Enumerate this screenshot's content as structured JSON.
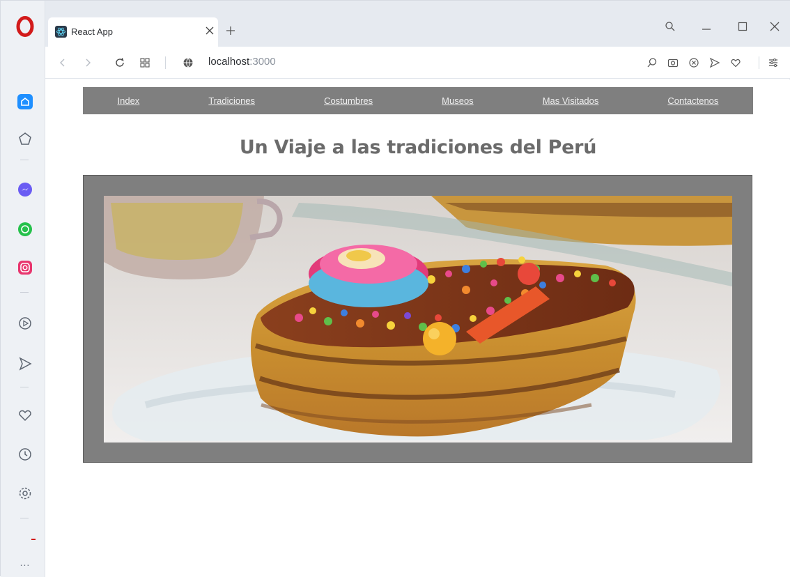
{
  "browser": {
    "tab_title": "React App",
    "url_host": "localhost",
    "url_port": ":3000"
  },
  "nav": {
    "items": [
      {
        "label": "Index"
      },
      {
        "label": "Tradiciones"
      },
      {
        "label": "Costumbres"
      },
      {
        "label": "Museos"
      },
      {
        "label": "Mas Visitados"
      },
      {
        "label": "Contactenos"
      }
    ]
  },
  "main": {
    "heading": "Un Viaje a las tradiciones del Perú"
  },
  "sidebar": {
    "more_label": "..."
  },
  "colors": {
    "nav_bg": "#7f7f7f",
    "frame_bg": "#7f7f7f",
    "heading": "#6b6b6b"
  }
}
